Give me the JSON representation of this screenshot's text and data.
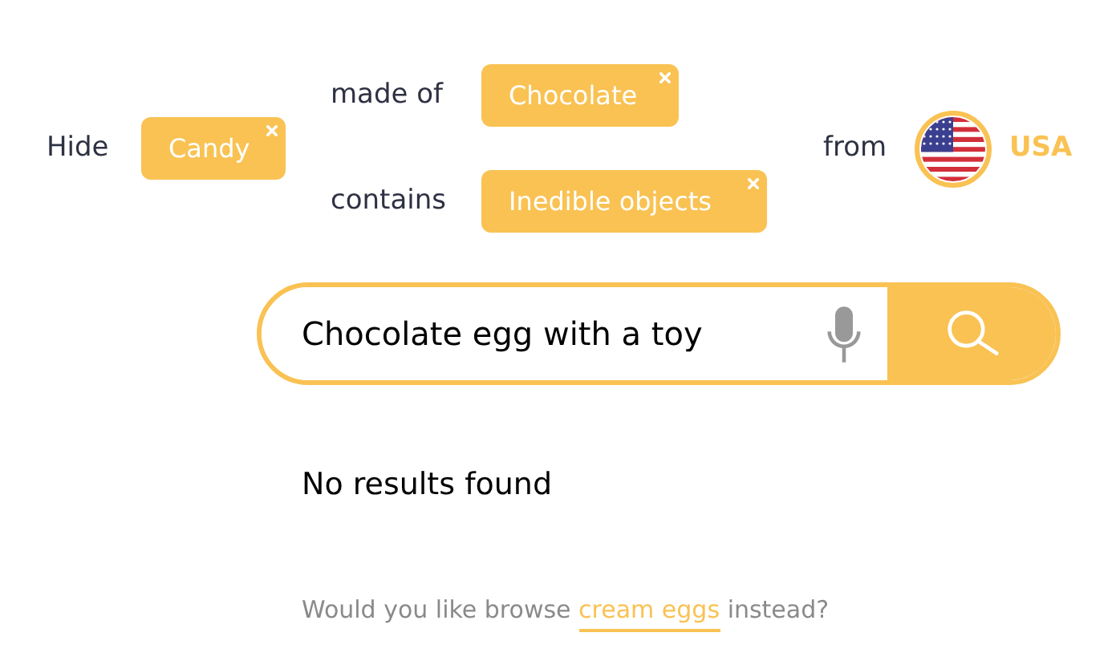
{
  "filters": {
    "hide_label": "Hide",
    "category": {
      "label": "Candy"
    },
    "conditions": [
      {
        "label": "made of",
        "chip": "Chocolate"
      },
      {
        "label": "contains",
        "chip": "Inedible objects"
      }
    ],
    "origin_label": "from",
    "country": "USA"
  },
  "search": {
    "value": "Chocolate egg with a toy"
  },
  "message": "No results found",
  "suggestion": {
    "before": "Would you like browse",
    "link": "cream eggs",
    "after": "instead?"
  }
}
